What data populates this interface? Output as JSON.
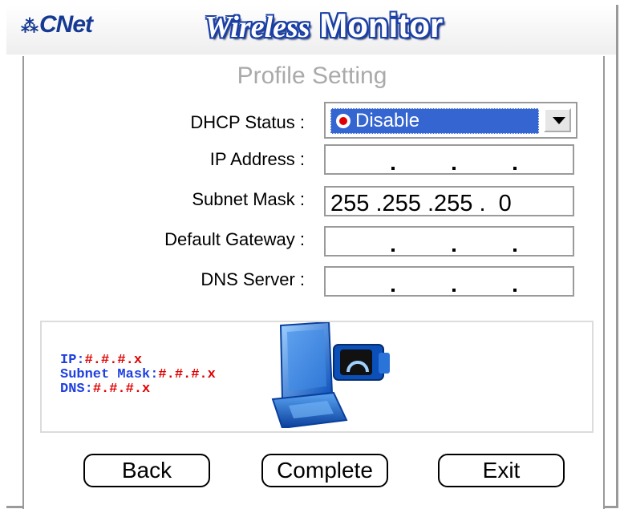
{
  "header": {
    "logo": "CNet",
    "title_script": "Wireless",
    "title_main": "Monitor"
  },
  "page_title": "Profile Setting",
  "form": {
    "dhcp_label": "DHCP Status :",
    "dhcp_value": "Disable",
    "ip_label": "IP Address :",
    "subnet_label": "Subnet Mask :",
    "subnet_value": "255 .255 .255 .  0",
    "gateway_label": "Default Gateway :",
    "dns_label": "DNS Server :"
  },
  "info": {
    "ip_prefix": "IP:",
    "ip_value": "#.#.#.x",
    "subnet_prefix": "Subnet Mask:",
    "subnet_value": "#.#.#.x",
    "dns_prefix": "DNS:",
    "dns_value": "#.#.#.x"
  },
  "buttons": {
    "back": "Back",
    "complete": "Complete",
    "exit": "Exit"
  },
  "colors": {
    "brand_blue": "#163a93",
    "select_highlight": "#3465d0",
    "info_blue": "#1f3fe0",
    "info_red": "#e00000"
  }
}
